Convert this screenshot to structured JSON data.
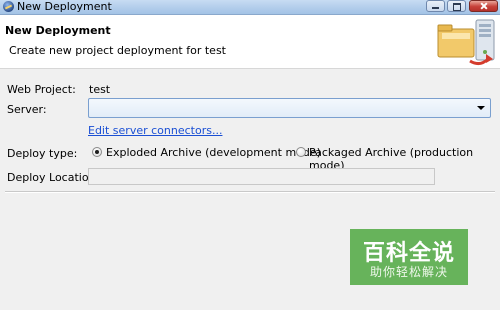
{
  "window": {
    "title": "New Deployment",
    "controls": {
      "minimize": "minimize-icon",
      "maximize": "maximize-icon",
      "close": "close-icon"
    }
  },
  "banner": {
    "title": "New Deployment",
    "description": "Create new project deployment for test",
    "graphic_icon": "deployment-server-icon"
  },
  "form": {
    "web_project": {
      "label": "Web Project:",
      "value": "test"
    },
    "server": {
      "label": "Server:",
      "selected": ""
    },
    "edit_link": "Edit server connectors...",
    "deploy_type": {
      "label": "Deploy type:",
      "options": [
        {
          "label": "Exploded Archive (development mode)",
          "selected": true
        },
        {
          "label": "Packaged Archive (production mode)",
          "selected": false
        }
      ]
    },
    "deploy_location": {
      "label": "Deploy Location:",
      "value": ""
    }
  },
  "watermark": {
    "main": "百科全说",
    "sub": "助你轻松解决"
  },
  "colors": {
    "titlebar": "#b2cdeb",
    "link": "#1a4fd4",
    "watermark_bg": "#67b35b",
    "window_bg": "#f0f0f0"
  }
}
